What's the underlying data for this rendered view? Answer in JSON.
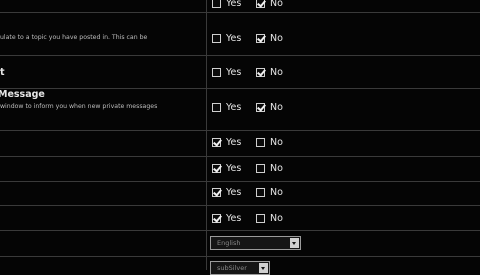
{
  "rows": [
    {
      "title": "",
      "desc": "",
      "yes_label": "Yes",
      "no_label": "No",
      "yes_checked": false,
      "no_checked": true
    },
    {
      "title": "",
      "desc": "ulate to a topic you have posted in. This can be",
      "yes_label": "Yes",
      "no_label": "No",
      "yes_checked": false,
      "no_checked": true
    },
    {
      "title": "t",
      "desc": "",
      "yes_label": "Yes",
      "no_label": "No",
      "yes_checked": false,
      "no_checked": true
    },
    {
      "title": "Message",
      "desc": "window to inform you when new private messages",
      "yes_label": "Yes",
      "no_label": "No",
      "yes_checked": false,
      "no_checked": true
    },
    {
      "title": "",
      "desc": "",
      "yes_label": "Yes",
      "no_label": "No",
      "yes_checked": true,
      "no_checked": false
    },
    {
      "title": "",
      "desc": "",
      "yes_label": "Yes",
      "no_label": "No",
      "yes_checked": true,
      "no_checked": false
    },
    {
      "title": "",
      "desc": "",
      "yes_label": "Yes",
      "no_label": "No",
      "yes_checked": true,
      "no_checked": false
    },
    {
      "title": "",
      "desc": "",
      "yes_label": "Yes",
      "no_label": "No",
      "yes_checked": true,
      "no_checked": false
    }
  ],
  "language_select": {
    "value": "English"
  },
  "style_select": {
    "value": "subSilver"
  }
}
